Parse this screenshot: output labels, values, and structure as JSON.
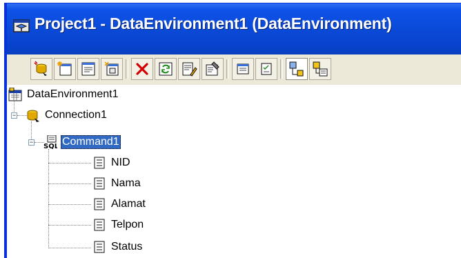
{
  "window": {
    "title": "Project1 - DataEnvironment1 (DataEnvironment)"
  },
  "toolbar": {
    "buttons": [
      {
        "name": "add-connection",
        "icon": "add-connection-icon"
      },
      {
        "name": "add-command",
        "icon": "add-command-icon"
      },
      {
        "name": "insert-stored-procedures",
        "icon": "insert-stored-procedures-icon"
      },
      {
        "name": "add-child-command",
        "icon": "add-child-command-icon"
      },
      {
        "name": "delete",
        "icon": "delete-icon"
      },
      {
        "name": "refresh",
        "icon": "refresh-icon"
      },
      {
        "name": "design",
        "icon": "design-icon"
      },
      {
        "name": "properties",
        "icon": "properties-icon"
      },
      {
        "name": "view-code",
        "icon": "view-code-icon"
      },
      {
        "name": "arrange-by-connections",
        "icon": "arrange-by-connections-icon"
      },
      {
        "name": "arrange-by-objects",
        "icon": "arrange-by-objects-icon"
      },
      {
        "name": "arrange-by-objects-2",
        "icon": "arrange-by-objects-icon"
      }
    ]
  },
  "tree": {
    "root": "DataEnvironment1",
    "connection": "Connection1",
    "command": "Command1",
    "fields": [
      "NID",
      "Nama",
      "Alamat",
      "Telpon",
      "Status"
    ]
  },
  "colors": {
    "titlebar": "#0a4ad8",
    "selection": "#316ac5",
    "delete_red": "#d40000"
  }
}
